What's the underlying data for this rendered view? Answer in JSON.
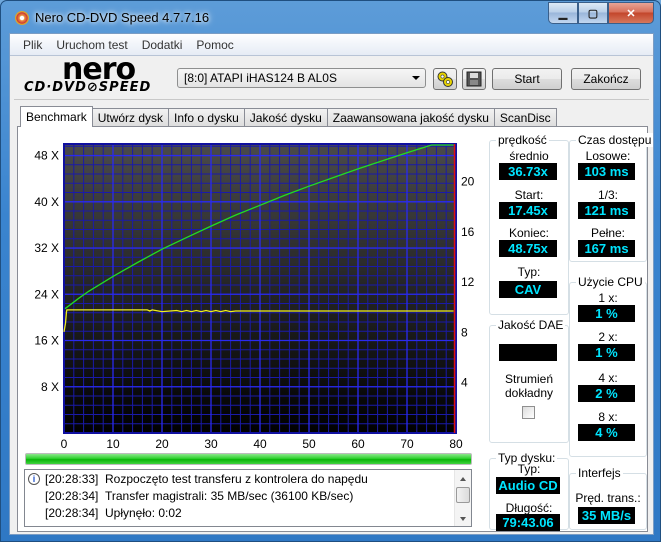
{
  "window": {
    "title": "Nero CD-DVD Speed 4.7.7.16",
    "controls": {
      "minimize": "▁",
      "maximize": "▢",
      "close": "✕"
    }
  },
  "menu": [
    "Plik",
    "Uruchom test",
    "Dodatki",
    "Pomoc"
  ],
  "logo": {
    "top": "nero",
    "bottom": "CD·DVD⊘SPEED"
  },
  "toolbar": {
    "drive": "[8:0]   ATAPI iHAS124   B AL0S",
    "start_label": "Start",
    "exit_label": "Zakończ",
    "settings_icon": "gears-icon",
    "save_icon": "floppy-disk-icon"
  },
  "tabs": [
    {
      "label": "Benchmark",
      "active": true
    },
    {
      "label": "Utwórz dysk"
    },
    {
      "label": "Info o dysku"
    },
    {
      "label": "Jakość dysku"
    },
    {
      "label": "Zaawansowana jakość dysku"
    },
    {
      "label": "ScanDisc"
    }
  ],
  "chart_data": {
    "type": "line",
    "title": "",
    "xlabel": "",
    "ylabel": "",
    "x_ticks": [
      "0",
      "10",
      "20",
      "30",
      "40",
      "50",
      "60",
      "70",
      "80"
    ],
    "xlim": [
      0,
      80
    ],
    "y_left_ticks": [
      "8 X",
      "16 X",
      "24 X",
      "32 X",
      "40 X",
      "48 X"
    ],
    "ylim_left": [
      0,
      50
    ],
    "y_right_ticks": [
      "4",
      "8",
      "12",
      "16",
      "20"
    ],
    "ylim_right": [
      0,
      23
    ],
    "grid": true,
    "end_marker_x": 79.7,
    "series": [
      {
        "name": "read speed",
        "color": "#22dd22",
        "axis": "left",
        "x": [
          0.2,
          1,
          3,
          5,
          10,
          15,
          20,
          25,
          30,
          35,
          40,
          45,
          50,
          55,
          60,
          65,
          70,
          75,
          79.5
        ],
        "values": [
          21.5,
          22.0,
          23.3,
          24.5,
          27.1,
          29.5,
          31.8,
          33.8,
          35.8,
          37.7,
          39.4,
          41.1,
          42.7,
          44.2,
          45.7,
          47.1,
          48.5,
          49.9,
          50.9
        ]
      },
      {
        "name": "cpu / transfer",
        "color": "#f0f020",
        "axis": "left",
        "x": [
          0,
          0.3,
          0.5,
          0.6,
          17,
          17.5,
          18,
          20,
          23,
          24,
          25,
          26,
          27,
          28,
          29,
          30,
          31,
          32,
          33,
          34,
          35,
          79.5
        ],
        "values": [
          17.5,
          19.0,
          21.0,
          21.3,
          21.3,
          21.1,
          21.3,
          21.0,
          21.2,
          21.0,
          21.2,
          21.0,
          21.2,
          21.0,
          21.2,
          21.0,
          21.2,
          21.0,
          21.2,
          21.0,
          21.1,
          21.1
        ]
      }
    ]
  },
  "speed": {
    "title": "prędkość",
    "avg_label": "średnio",
    "avg": "36.73x",
    "start_label": "Start:",
    "start": "17.45x",
    "end_label": "Koniec:",
    "end": "48.75x",
    "type_label": "Typ:",
    "type": "CAV"
  },
  "access": {
    "title": "Czas dostępu",
    "random_label": "Losowe:",
    "random": "103 ms",
    "third_label": "1/3:",
    "third": "121 ms",
    "full_label": "Pełne:",
    "full": "167 ms"
  },
  "cpu": {
    "title": "Użycie CPU",
    "rows": [
      {
        "label": "1 x:",
        "value": "1 %"
      },
      {
        "label": "2 x:",
        "value": "1 %"
      },
      {
        "label": "4 x:",
        "value": "2 %"
      },
      {
        "label": "8 x:",
        "value": "4 %"
      }
    ]
  },
  "dae": {
    "title": "Jakość DAE",
    "value": "",
    "accurate_label": "Strumień dokładny",
    "accurate_checked": false
  },
  "disc": {
    "title": "Typ dysku:",
    "type_label": "Typ:",
    "type": "Audio CD",
    "length_label": "Długość:",
    "length": "79:43.06"
  },
  "iface": {
    "title": "Interfejs",
    "rate_label": "Pręd. trans.:",
    "rate": "35 MB/s"
  },
  "progress": {
    "percent": 100,
    "color": "#22cc22"
  },
  "log": [
    {
      "time": "[20:28:33]",
      "msg": "Rozpoczęto test transferu z kontrolera do napędu",
      "icon": "info-icon"
    },
    {
      "time": "[20:28:34]",
      "msg": "Transfer magistrali: 35 MB/sec (36100 KB/sec)"
    },
    {
      "time": "[20:28:34]",
      "msg": "Upłynęło:  0:02"
    }
  ]
}
